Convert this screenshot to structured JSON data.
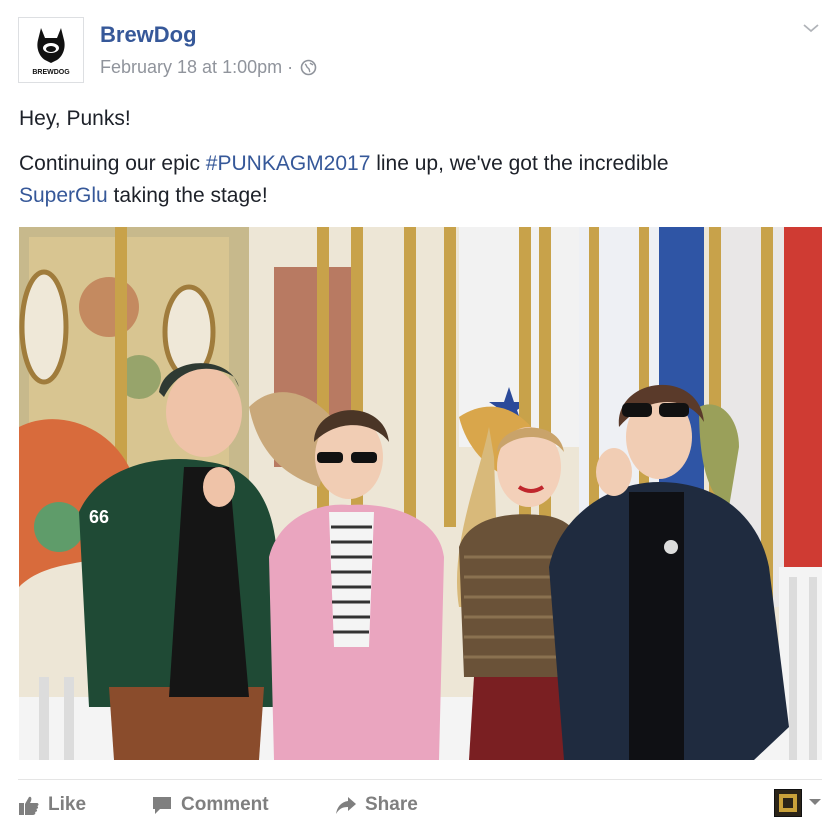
{
  "post": {
    "author": "BrewDog",
    "timestamp": "February 18 at 1:00pm",
    "separator": "·",
    "logo_text": "BREWDOG",
    "line1": "Hey, Punks!",
    "line2_prefix": "Continuing our epic ",
    "hashtag": "#PUNKAGM2017",
    "line2_suffix": " line up, we've got the incredible",
    "mention": "SuperGlu",
    "line3_suffix": " taking the stage!"
  },
  "photo": {
    "description_icon": "group-photo-carousel",
    "jacket_number": "66"
  },
  "actions": {
    "like_label": "Like",
    "comment_label": "Comment",
    "share_label": "Share"
  },
  "colors": {
    "link": "#365899",
    "meta": "#90949c",
    "action": "#7f7f7f"
  },
  "icons": {
    "privacy": "globe-icon",
    "options": "chevron-down-icon",
    "like": "thumbs-up-icon",
    "comment": "comment-bubble-icon",
    "share": "share-arrow-icon"
  }
}
